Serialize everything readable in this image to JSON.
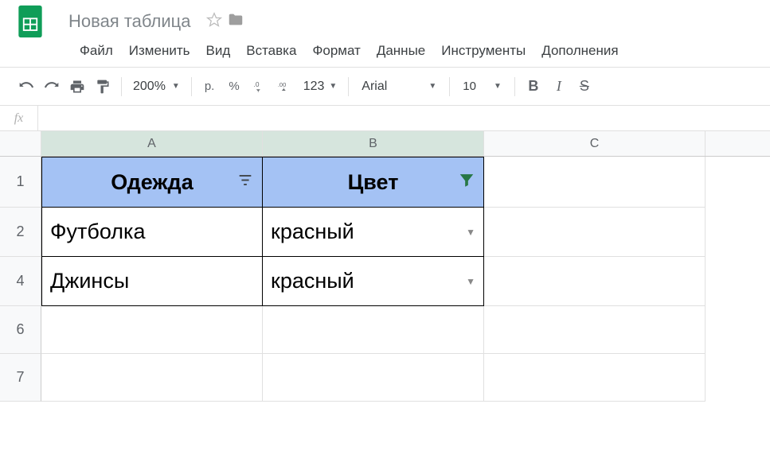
{
  "doc": {
    "title": "Новая таблица"
  },
  "menubar": [
    "Файл",
    "Изменить",
    "Вид",
    "Вставка",
    "Формат",
    "Данные",
    "Инструменты",
    "Дополнения"
  ],
  "toolbar": {
    "zoom": "200%",
    "currency": "р.",
    "percent": "%",
    "dec_dec": ".0",
    "dec_inc": ".00",
    "num_fmt": "123",
    "font": "Arial",
    "size": "10"
  },
  "formula": {
    "fx": "fx",
    "value": ""
  },
  "columns": [
    "A",
    "B",
    "C"
  ],
  "selected_columns": [
    "A",
    "B"
  ],
  "row_numbers": [
    "1",
    "2",
    "4",
    "6",
    "7"
  ],
  "table": {
    "headers": [
      "Одежда",
      "Цвет"
    ],
    "rows": [
      {
        "a": "Футболка",
        "b": "красный"
      },
      {
        "a": "Джинсы",
        "b": "красный"
      }
    ]
  }
}
